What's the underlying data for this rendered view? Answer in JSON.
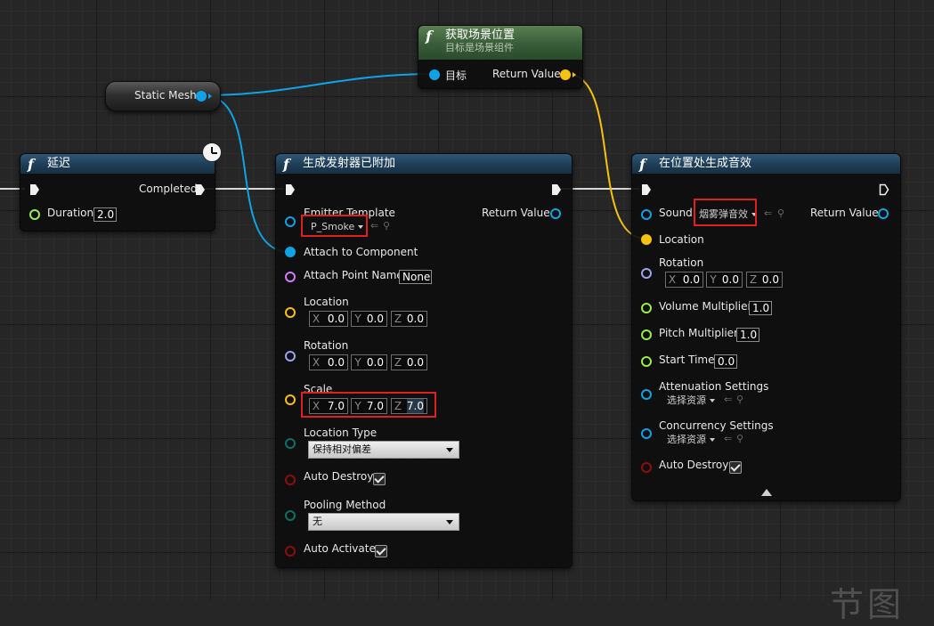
{
  "colors": {
    "exec": "#f0f0f0",
    "object": "#0fa3e6",
    "vector": "#f4c20f",
    "rotator": "#a1a1ef",
    "float": "#9aec4a",
    "string": "#d47cf5",
    "byte": "#0c6f68",
    "bool": "#8e0d0d",
    "struct": "#0c5fa0",
    "highlight": "#e0201e"
  },
  "static_mesh": {
    "label": "Static Mesh"
  },
  "get_location": {
    "title": "获取场景位置",
    "subtitle": "目标是场景组件",
    "target_label": "目标",
    "return_label": "Return Value"
  },
  "delay": {
    "title": "延迟",
    "completed_label": "Completed",
    "duration_label": "Duration",
    "duration_value": "2.0"
  },
  "spawn_emitter": {
    "title": "生成发射器已附加",
    "emitter_template_label": "Emitter Template",
    "emitter_template_value": "P_Smoke",
    "return_label": "Return Value",
    "attach_to_component_label": "Attach to Component",
    "attach_point_name_label": "Attach Point Name",
    "attach_point_name_value": "None",
    "location_label": "Location",
    "location": {
      "x": "0.0",
      "y": "0.0",
      "z": "0.0"
    },
    "rotation_label": "Rotation",
    "rotation": {
      "x": "0.0",
      "y": "0.0",
      "z": "0.0"
    },
    "scale_label": "Scale",
    "scale": {
      "x": "7.0",
      "y": "7.0",
      "z": "7.0"
    },
    "location_type_label": "Location Type",
    "location_type_value": "保持相对偏差",
    "auto_destroy_label": "Auto Destroy",
    "pooling_method_label": "Pooling Method",
    "pooling_method_value": "无",
    "auto_activate_label": "Auto Activate"
  },
  "spawn_sound": {
    "title": "在位置处生成音效",
    "sound_label": "Sound",
    "sound_value": "烟雾弹音效",
    "return_label": "Return Value",
    "location_label": "Location",
    "rotation_label": "Rotation",
    "rotation": {
      "x": "0.0",
      "y": "0.0",
      "z": "0.0"
    },
    "volume_multiplier_label": "Volume Multiplier",
    "volume_multiplier_value": "1.0",
    "pitch_multiplier_label": "Pitch Multiplier",
    "pitch_multiplier_value": "1.0",
    "start_time_label": "Start Time",
    "start_time_value": "0.0",
    "attenuation_settings_label": "Attenuation Settings",
    "attenuation_settings_value": "选择资源",
    "concurrency_settings_label": "Concurrency Settings",
    "concurrency_settings_value": "选择资源",
    "auto_destroy_label": "Auto Destroy"
  },
  "axis_labels": {
    "x": "X",
    "y": "Y",
    "z": "Z"
  },
  "watermark": "节图"
}
